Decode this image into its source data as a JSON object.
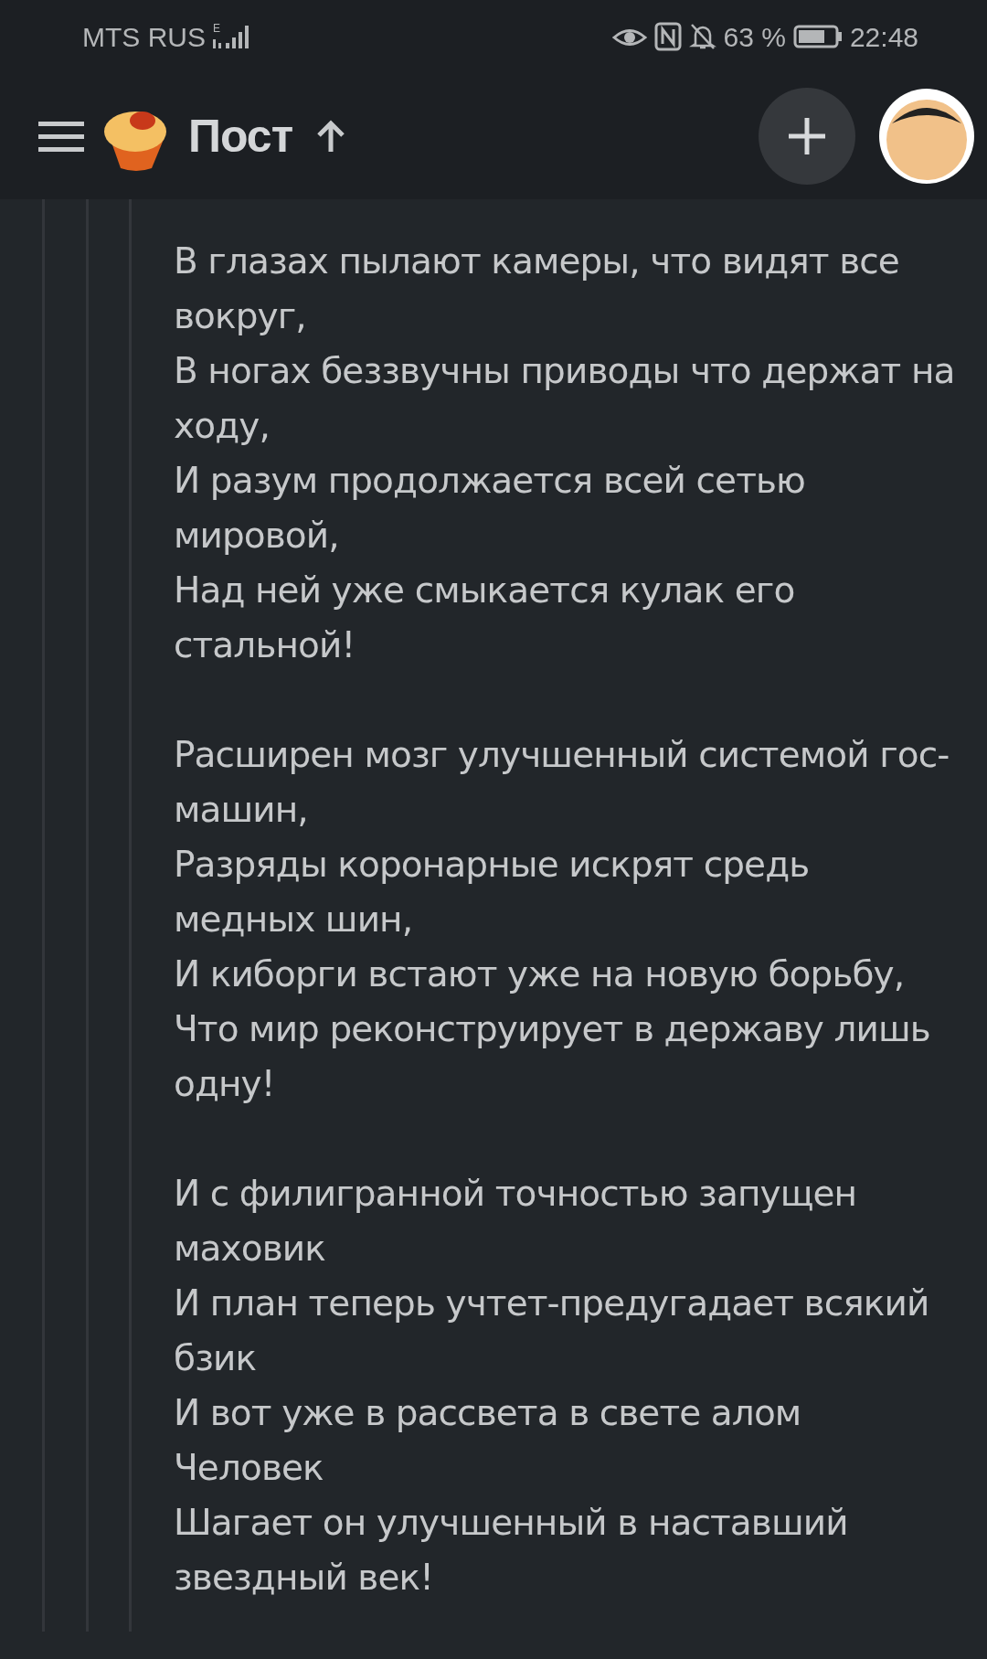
{
  "status_bar": {
    "carrier": "MTS RUS",
    "network": "E",
    "battery_percent": "63 %",
    "time": "22:48"
  },
  "header": {
    "title": "Пост"
  },
  "comment": {
    "stanzas": [
      [
        "В глазах пылают камеры, что видят все вокруг,",
        "В ногах беззвучны приводы что держат на ходу,",
        "И разум продолжается всей сетью мировой,",
        "Над ней уже смыкается кулак его стальной!"
      ],
      [
        "Расширен мозг улучшенный системой гос-машин,",
        "Разряды коронарные искрят средь медных шин,",
        "И киборги встают уже на новую борьбу,",
        "Что мир реконструирует в державу лишь одну!"
      ],
      [
        "И с филигранной точностью запущен маховик",
        "И план теперь учтет-предугадает всякий бзик",
        "И вот уже в рассвета в свете алом Человек",
        "Шагает он улучшенный в наставший звездный век!"
      ]
    ]
  }
}
